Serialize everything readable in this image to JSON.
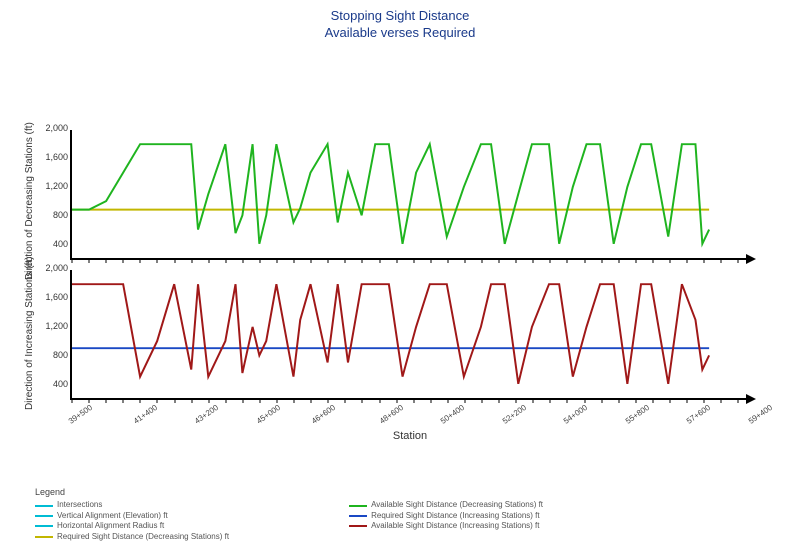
{
  "title": {
    "line1": "Stopping Sight Distance",
    "line2": "Available verses Required"
  },
  "xlabel": "Station",
  "panel1": {
    "ylabel": "Direction of Decreasing Stations (ft)"
  },
  "panel2": {
    "ylabel": "Direction of Increasing Stations (ft)"
  },
  "yticks": [
    "400",
    "800",
    "1,200",
    "1,600",
    "2,000"
  ],
  "xticks": [
    "39+500",
    "41+400",
    "43+200",
    "45+000",
    "46+600",
    "48+600",
    "50+400",
    "52+200",
    "54+000",
    "55+800",
    "57+600",
    "59+400"
  ],
  "legend": {
    "header": "Legend",
    "left": [
      {
        "label": "Intersections",
        "color": "#00bcd4"
      },
      {
        "label": "Vertical Alignment (Elevation)  ft",
        "color": "#00bcd4"
      },
      {
        "label": "Horizontal Alignment Radius  ft",
        "color": "#00bcd4"
      },
      {
        "label": "Required Sight Distance (Decreasing Stations)  ft",
        "color": "#c2b600"
      }
    ],
    "right": [
      {
        "label": "Available Sight Distance (Decreasing Stations)  ft",
        "color": "#1fb41f"
      },
      {
        "label": "Required Sight Distance (Increasing Stations)  ft",
        "color": "#1a48c4"
      },
      {
        "label": "Available Sight Distance (Increasing Stations)  ft",
        "color": "#a01818"
      }
    ]
  },
  "chart_data": [
    {
      "type": "line",
      "title": "Direction of Decreasing Stations",
      "xlabel": "Station",
      "ylabel": "Direction of Decreasing Stations (ft)",
      "ylim": [
        200,
        2000
      ],
      "x": [
        39.5,
        40.0,
        40.5,
        41.0,
        41.5,
        42.0,
        42.5,
        43.0,
        43.2,
        43.5,
        44.0,
        44.3,
        44.5,
        44.8,
        45.0,
        45.2,
        45.5,
        46.0,
        46.2,
        46.5,
        47.0,
        47.3,
        47.6,
        48.0,
        48.4,
        48.8,
        49.2,
        49.6,
        50.0,
        50.5,
        51.0,
        51.5,
        51.8,
        52.2,
        52.6,
        53.0,
        53.5,
        53.8,
        54.2,
        54.6,
        55.0,
        55.4,
        55.8,
        56.2,
        56.5,
        57.0,
        57.4,
        57.8,
        58.0,
        58.2
      ],
      "series": [
        {
          "name": "Required Sight Distance (Decreasing Stations)",
          "color": "#c2b600",
          "values": [
            880,
            880,
            880,
            880,
            880,
            880,
            880,
            880,
            880,
            880,
            880,
            880,
            880,
            880,
            880,
            880,
            880,
            880,
            880,
            880,
            880,
            880,
            880,
            880,
            880,
            880,
            880,
            880,
            880,
            880,
            880,
            880,
            880,
            880,
            880,
            880,
            880,
            880,
            880,
            880,
            880,
            880,
            880,
            880,
            880,
            880,
            880,
            880,
            880,
            880
          ]
        },
        {
          "name": "Available Sight Distance (Decreasing Stations)",
          "color": "#1fb41f",
          "values": [
            880,
            880,
            1000,
            1400,
            1800,
            1800,
            1800,
            1800,
            600,
            1100,
            1800,
            550,
            800,
            1800,
            400,
            800,
            1800,
            700,
            900,
            1400,
            1800,
            700,
            1400,
            800,
            1800,
            1800,
            400,
            1400,
            1800,
            500,
            1200,
            1800,
            1800,
            400,
            1100,
            1800,
            1800,
            400,
            1200,
            1800,
            1800,
            400,
            1200,
            1800,
            1800,
            500,
            1800,
            1800,
            400,
            600
          ]
        }
      ]
    },
    {
      "type": "line",
      "title": "Direction of Increasing Stations",
      "xlabel": "Station",
      "ylabel": "Direction of Increasing Stations (ft)",
      "ylim": [
        200,
        2000
      ],
      "x": [
        39.5,
        40.0,
        40.5,
        41.0,
        41.5,
        42.0,
        42.5,
        43.0,
        43.2,
        43.5,
        44.0,
        44.3,
        44.5,
        44.8,
        45.0,
        45.2,
        45.5,
        46.0,
        46.2,
        46.5,
        47.0,
        47.3,
        47.6,
        48.0,
        48.4,
        48.8,
        49.2,
        49.6,
        50.0,
        50.5,
        51.0,
        51.5,
        51.8,
        52.2,
        52.6,
        53.0,
        53.5,
        53.8,
        54.2,
        54.6,
        55.0,
        55.4,
        55.8,
        56.2,
        56.5,
        57.0,
        57.4,
        57.8,
        58.0,
        58.2
      ],
      "series": [
        {
          "name": "Required Sight Distance (Increasing Stations)",
          "color": "#1a48c4",
          "values": [
            900,
            900,
            900,
            900,
            900,
            900,
            900,
            900,
            900,
            900,
            900,
            900,
            900,
            900,
            900,
            900,
            900,
            900,
            900,
            900,
            900,
            900,
            900,
            900,
            900,
            900,
            900,
            900,
            900,
            900,
            900,
            900,
            900,
            900,
            900,
            900,
            900,
            900,
            900,
            900,
            900,
            900,
            900,
            900,
            900,
            900,
            900,
            900,
            900,
            900
          ]
        },
        {
          "name": "Available Sight Distance (Increasing Stations)",
          "color": "#a01818",
          "values": [
            1800,
            1800,
            1800,
            1800,
            500,
            1000,
            1800,
            600,
            1800,
            500,
            1000,
            1800,
            550,
            1200,
            800,
            1000,
            1800,
            500,
            1300,
            1800,
            700,
            1800,
            700,
            1800,
            1800,
            1800,
            500,
            1200,
            1800,
            1800,
            500,
            1200,
            1800,
            1800,
            400,
            1200,
            1800,
            1800,
            500,
            1200,
            1800,
            1800,
            400,
            1800,
            1800,
            400,
            1800,
            1300,
            600,
            800
          ]
        }
      ]
    }
  ]
}
